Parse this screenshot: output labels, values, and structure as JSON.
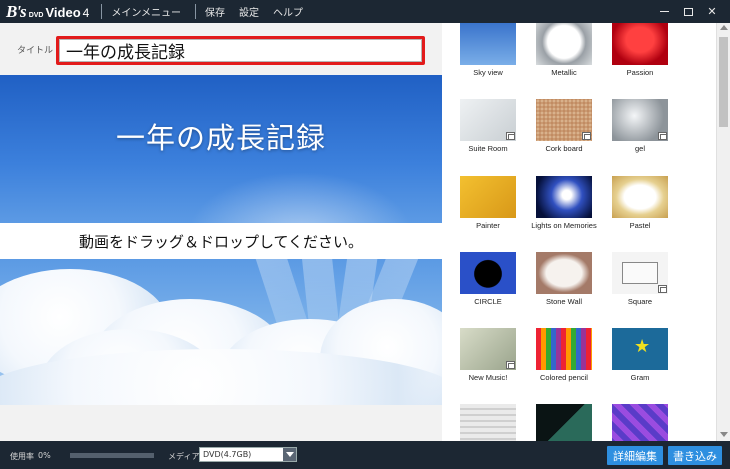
{
  "app": {
    "logo_b": "B's",
    "logo_dvd": "DVD",
    "logo_video": "Video",
    "logo_version": "4"
  },
  "menu": [
    {
      "label": "メインメニュー"
    },
    {
      "label": "保存"
    },
    {
      "label": "設定"
    },
    {
      "label": "ヘルプ"
    }
  ],
  "window_controls": {
    "close": "✕"
  },
  "editor": {
    "title_label": "タイトル",
    "title_value": "一年の成長記録"
  },
  "preview": {
    "title_text": "一年の成長記録",
    "drop_hint": "動画をドラッグ＆ドロップしてください。"
  },
  "themes": [
    {
      "label": "Sky view",
      "color": "#4a7fd0"
    },
    {
      "label": "Metallic",
      "color": "#b9bec4"
    },
    {
      "label": "Passion",
      "color": "#c8121a"
    },
    {
      "label": "Suite Room",
      "color": "#d8dde0"
    },
    {
      "label": "Cork board",
      "color": "#c79a72"
    },
    {
      "label": "gel",
      "color": "#9ea4aa"
    },
    {
      "label": "Painter",
      "color": "#e4b11c"
    },
    {
      "label": "Lights on Memories",
      "color": "#0a1c6a"
    },
    {
      "label": "Pastel",
      "color": "#e0d08c"
    },
    {
      "label": "CIRCLE",
      "color": "#3157c4"
    },
    {
      "label": "Stone Wall",
      "color": "#a98070"
    },
    {
      "label": "Square",
      "color": "#f0f0f0"
    },
    {
      "label": "New Music!",
      "color": "#b9c0a8"
    },
    {
      "label": "Colored pencil",
      "color": "#e8e8e8"
    },
    {
      "label": "Gram",
      "color": "#1c6a9a"
    },
    {
      "label": "",
      "color": "#d8d8d8"
    },
    {
      "label": "",
      "color": "#1a2a2a"
    },
    {
      "label": "",
      "color": "#5a3cc8"
    }
  ],
  "status": {
    "usage_label": "使用率",
    "usage_percent": "0%",
    "usage_fraction": 0.0,
    "media_label": "メディア",
    "media_value": "DVD(4.7GB)"
  },
  "buttons": {
    "edit": "詳細編集",
    "write": "書き込み"
  }
}
